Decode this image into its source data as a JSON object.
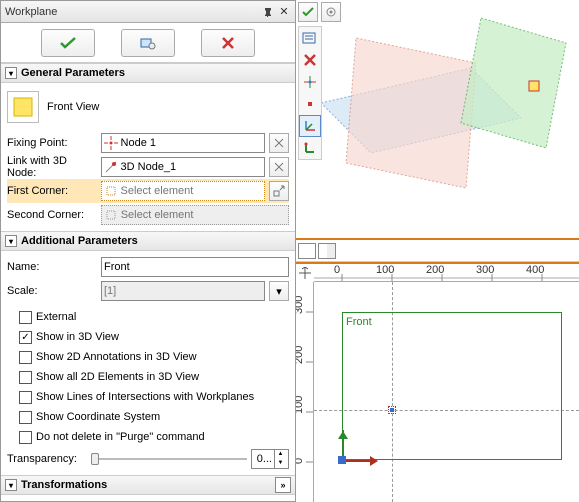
{
  "panel": {
    "title": "Workplane"
  },
  "sections": {
    "general": "General Parameters",
    "additional": "Additional Parameters",
    "transformations": "Transformations"
  },
  "general": {
    "view_type": "Front View",
    "fixing_point": {
      "label": "Fixing Point:",
      "value": "Node 1"
    },
    "link_3d": {
      "label": "Link with 3D Node:",
      "value": "3D Node_1"
    },
    "first_corner": {
      "label": "First Corner:",
      "placeholder": "Select element"
    },
    "second_corner": {
      "label": "Second Corner:",
      "placeholder": "Select element"
    }
  },
  "additional": {
    "name": {
      "label": "Name:",
      "value": "Front"
    },
    "scale": {
      "label": "Scale:",
      "value": "[1]"
    },
    "checks": [
      "External",
      "Show in 3D View",
      "Show 2D Annotations in 3D View",
      "Show all 2D Elements in 3D View",
      "Show Lines of Intersections with Workplanes",
      "Show Coordinate System",
      "Do not delete in \"Purge\" command"
    ],
    "checked_index": 1,
    "transparency": {
      "label": "Transparency:",
      "value": "0..."
    }
  },
  "viewport2d": {
    "label": "Front",
    "ruler_h": [
      0,
      100,
      200,
      300,
      400
    ],
    "ruler_v": [
      300,
      200,
      100,
      0
    ]
  },
  "colors": {
    "accent_highlight": "#ffe7b8",
    "plane_front": "#f7d7d0",
    "plane_top": "#cfe3f5",
    "plane_right": "#c7eec7",
    "axis_x": "#aa3020",
    "axis_y": "#2a8a2a",
    "origin": "#3a6acc"
  }
}
